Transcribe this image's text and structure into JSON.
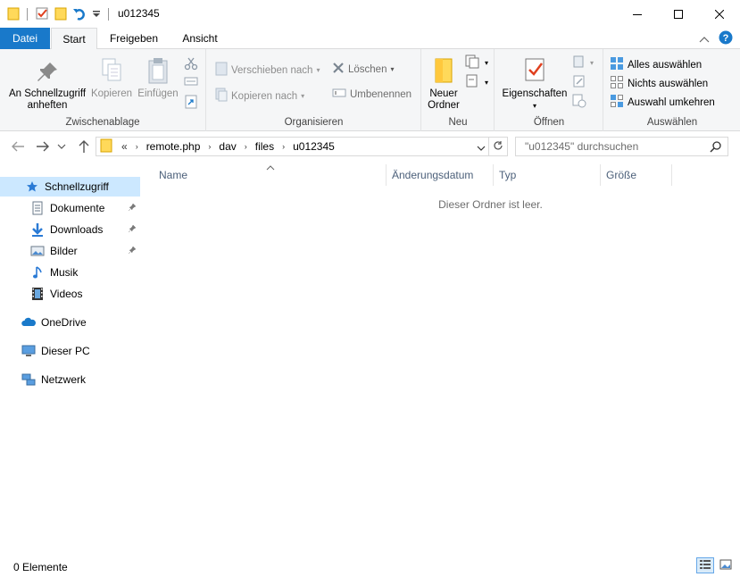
{
  "window": {
    "title": "u012345"
  },
  "tabs": {
    "datei": "Datei",
    "start": "Start",
    "freigeben": "Freigeben",
    "ansicht": "Ansicht"
  },
  "ribbon": {
    "zwischenablage": {
      "label": "Zwischenablage",
      "pin_line1": "An Schnellzugriff",
      "pin_line2": "anheften",
      "kopieren": "Kopieren",
      "einfuegen": "Einfügen"
    },
    "organisieren": {
      "label": "Organisieren",
      "verschieben": "Verschieben nach",
      "kopieren_nach": "Kopieren nach",
      "loeschen": "Löschen",
      "umbenennen": "Umbenennen"
    },
    "neu": {
      "label": "Neu",
      "ordner_line1": "Neuer",
      "ordner_line2": "Ordner"
    },
    "oeffnen": {
      "label": "Öffnen",
      "eigenschaften": "Eigenschaften"
    },
    "auswaehlen": {
      "label": "Auswählen",
      "alles": "Alles auswählen",
      "nichts": "Nichts auswählen",
      "umkehren": "Auswahl umkehren"
    }
  },
  "address": {
    "overflow": "«",
    "crumbs": [
      "remote.php",
      "dav",
      "files",
      "u012345"
    ],
    "search_placeholder": "\"u012345\" durchsuchen"
  },
  "navpane": {
    "items": [
      {
        "label": "Schnellzugriff",
        "icon": "star-icon"
      },
      {
        "label": "Dokumente",
        "icon": "documents-icon"
      },
      {
        "label": "Downloads",
        "icon": "download-icon"
      },
      {
        "label": "Bilder",
        "icon": "pictures-icon"
      },
      {
        "label": "Musik",
        "icon": "music-icon"
      },
      {
        "label": "Videos",
        "icon": "video-icon"
      },
      {
        "label": "OneDrive",
        "icon": "cloud-icon"
      },
      {
        "label": "Dieser PC",
        "icon": "computer-icon"
      },
      {
        "label": "Netzwerk",
        "icon": "network-icon"
      }
    ]
  },
  "columns": [
    "Name",
    "Änderungsdatum",
    "Typ",
    "Größe"
  ],
  "empty_message": "Dieser Ordner ist leer.",
  "status": {
    "text": "0 Elemente"
  },
  "colors": {
    "accent": "#1979ca",
    "selected": "#cce8ff",
    "folder": "#ffd95a"
  }
}
